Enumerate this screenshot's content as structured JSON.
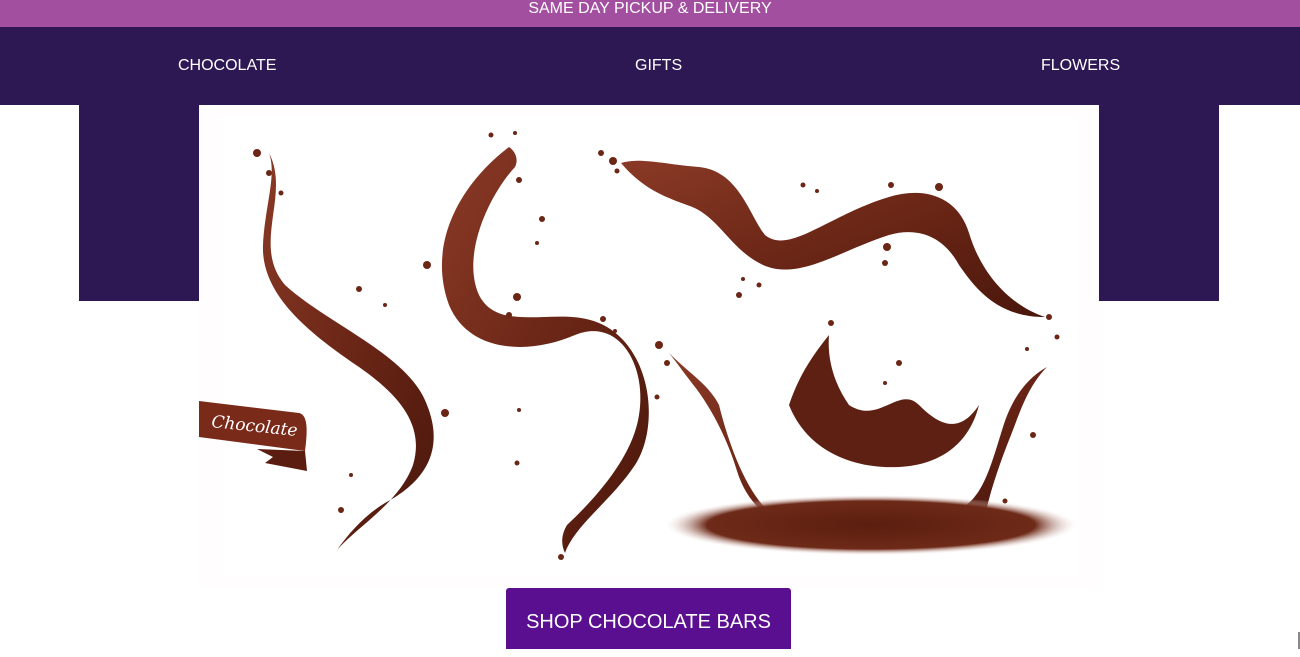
{
  "promo": {
    "text": "SAME DAY PICKUP & DELIVERY",
    "color": "#a24fa0"
  },
  "nav": {
    "background": "#2d1854",
    "items": [
      {
        "label": "CHOCOLATE"
      },
      {
        "label": "GIFTS"
      },
      {
        "label": "FLOWERS"
      }
    ]
  },
  "hero": {
    "ribbon_text": "Chocolate",
    "cta_label": "SHOP CHOCOLATE BARS",
    "cta_color": "#5a0f91"
  }
}
